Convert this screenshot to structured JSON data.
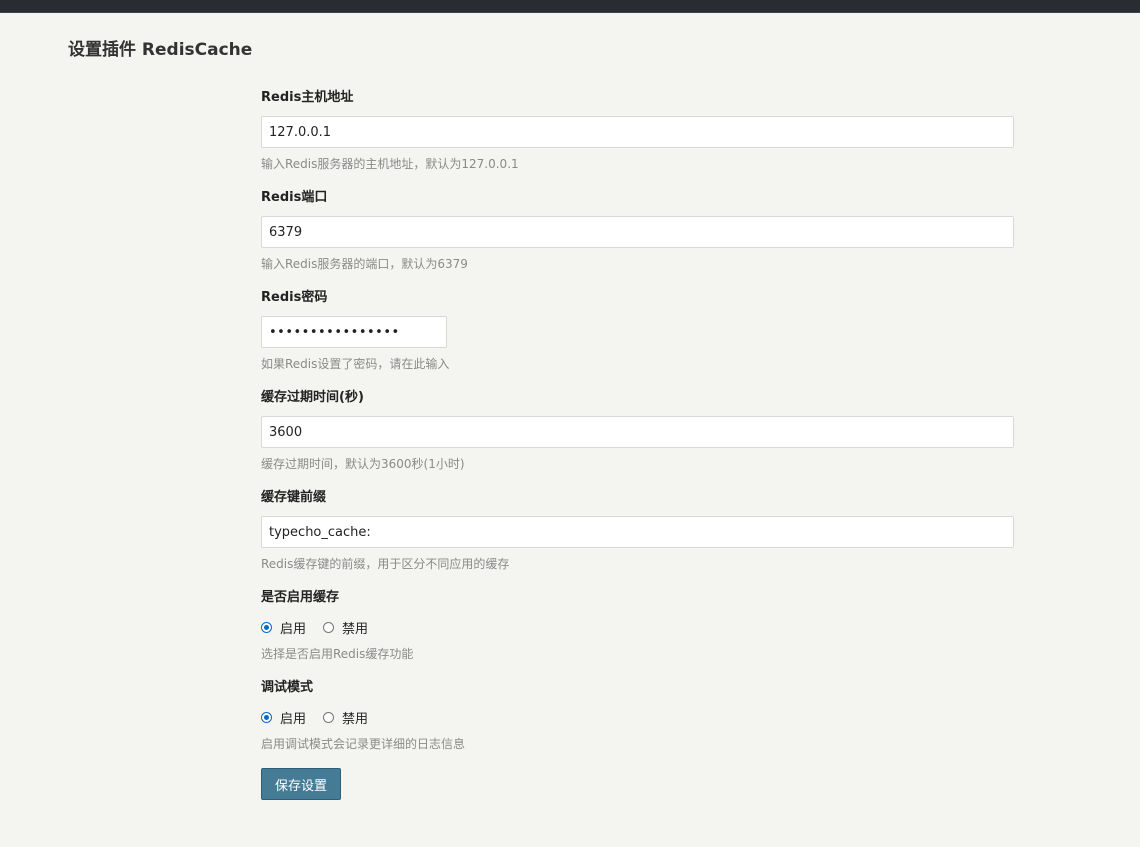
{
  "page": {
    "title": "设置插件 RedisCache"
  },
  "fields": [
    {
      "label": "Redis主机地址",
      "value": "127.0.0.1",
      "description": "输入Redis服务器的主机地址，默认为127.0.0.1"
    },
    {
      "label": "Redis端口",
      "value": "6379",
      "description": "输入Redis服务器的端口，默认为6379"
    },
    {
      "label": "Redis密码",
      "value": "••••••••••••••••",
      "description": "如果Redis设置了密码，请在此输入"
    },
    {
      "label": "缓存过期时间(秒)",
      "value": "3600",
      "description": "缓存过期时间，默认为3600秒(1小时)"
    },
    {
      "label": "缓存键前缀",
      "value": "typecho_cache:",
      "description": "Redis缓存键的前缀，用于区分不同应用的缓存"
    }
  ],
  "radios": [
    {
      "label": "是否启用缓存",
      "options": [
        {
          "label": "启用",
          "checked": true
        },
        {
          "label": "禁用",
          "checked": false
        }
      ],
      "description": "选择是否启用Redis缓存功能"
    },
    {
      "label": "调试模式",
      "options": [
        {
          "label": "启用",
          "checked": true
        },
        {
          "label": "禁用",
          "checked": false
        }
      ],
      "description": "启用调试模式会记录更详细的日志信息"
    }
  ],
  "actions": {
    "submit_label": "保存设置"
  },
  "colors": {
    "button_bg": "#467b96",
    "radio_checked": "#0b68c9",
    "page_bg": "#f4f4f0"
  }
}
